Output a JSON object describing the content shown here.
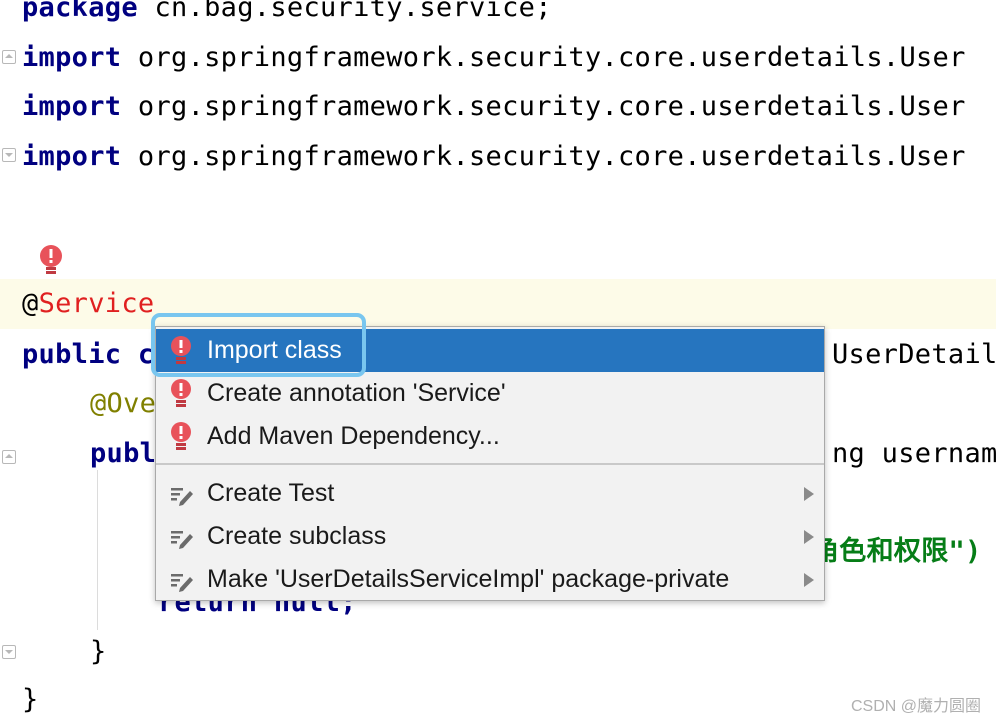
{
  "code": {
    "line1": {
      "keyword": "package",
      "rest": " cn.bag.security.service;"
    },
    "line2": {
      "keyword": "import",
      "rest": " org.springframework.security.core.userdetails.User"
    },
    "line3": {
      "keyword": "import",
      "rest": " org.springframework.security.core.userdetails.User"
    },
    "line4": {
      "keyword": "import",
      "rest": " org.springframework.security.core.userdetails.User"
    },
    "line5": {
      "at": "@",
      "annotation": "Service"
    },
    "line6": {
      "keyword": "public",
      "rest": " c",
      "tail": "UserDetail"
    },
    "line7": {
      "annotation": "@Ove"
    },
    "line8": {
      "keyword": "publ",
      "tail": "ng username"
    },
    "line9": {
      "string": "角色和权限\")"
    },
    "line10": {
      "text": "return null;"
    },
    "line11": {
      "text": "}"
    },
    "line12": {
      "text": "}"
    }
  },
  "popup": {
    "items": [
      {
        "label": "Import class"
      },
      {
        "label": "Create annotation 'Service'"
      },
      {
        "label": "Add Maven Dependency..."
      },
      {
        "label": "Create Test"
      },
      {
        "label": "Create subclass"
      },
      {
        "label": "Make 'UserDetailsServiceImpl' package-private"
      }
    ]
  },
  "watermark": "CSDN @魔力圆圈",
  "colors": {
    "selection": "#2675bf",
    "error": "#e02020",
    "keyword": "#000080",
    "focus_ring": "#79c6ef"
  },
  "icons": {
    "bulb": "error-bulb-icon",
    "quickfix": "quickfix-bulb-icon",
    "intention": "intention-pencil-icon",
    "submenu": "chevron-right-icon"
  }
}
